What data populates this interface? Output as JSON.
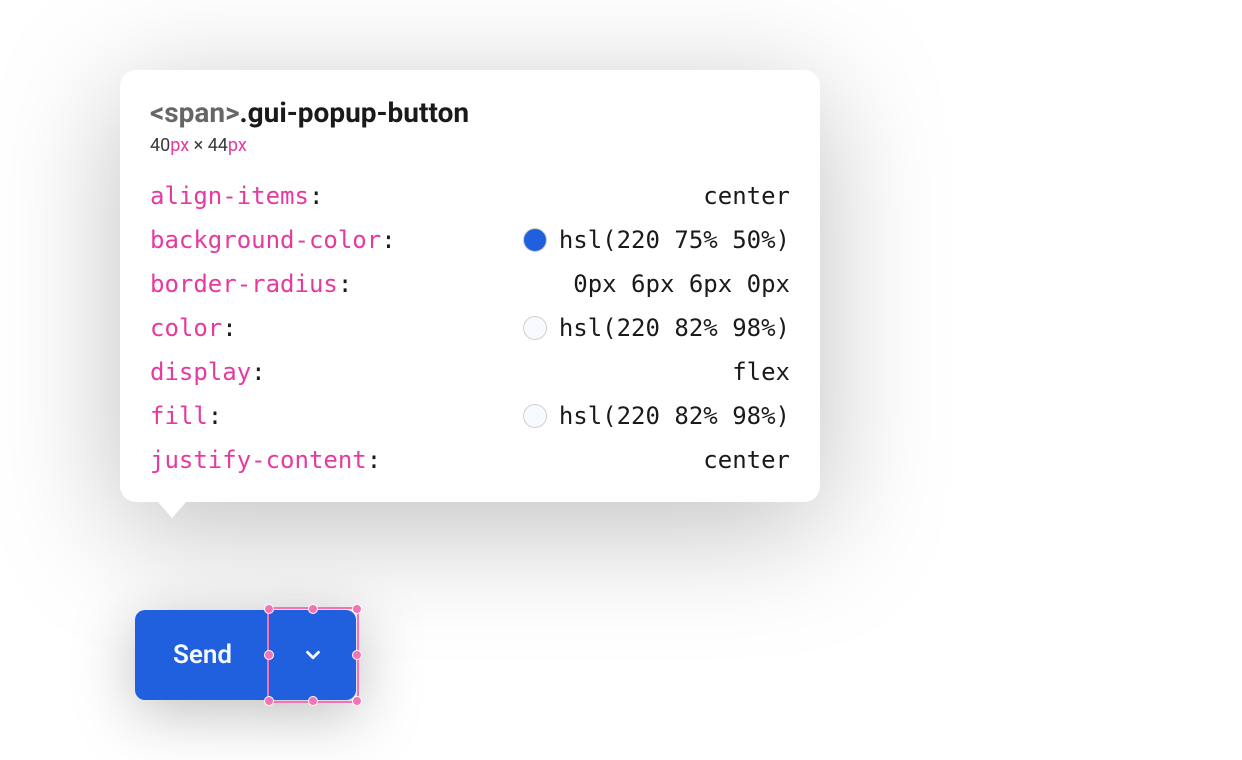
{
  "tooltip": {
    "tag_open": "<span>",
    "class_name": ".gui-popup-button",
    "width": "40",
    "height": "44",
    "unit": "px",
    "sep": " × "
  },
  "styles": {
    "rows": [
      {
        "prop": "align-items",
        "value": "center",
        "swatch": null
      },
      {
        "prop": "background-color",
        "value": "hsl(220 75% 50%)",
        "swatch": "hsl(220 75% 50%)"
      },
      {
        "prop": "border-radius",
        "value": "0px 6px 6px 0px",
        "swatch": null
      },
      {
        "prop": "color",
        "value": "hsl(220 82% 98%)",
        "swatch": "hsl(220 82% 98%)"
      },
      {
        "prop": "display",
        "value": "flex",
        "swatch": null
      },
      {
        "prop": "fill",
        "value": "hsl(220 82% 98%)",
        "swatch": "hsl(220 82% 98%)"
      },
      {
        "prop": "justify-content",
        "value": "center",
        "swatch": null
      }
    ]
  },
  "button": {
    "send_label": "Send"
  },
  "colors": {
    "accent": "hsl(220 75% 50%)",
    "text_on_accent": "hsl(220 82% 98%)",
    "selection_pink": "#f472b6"
  }
}
